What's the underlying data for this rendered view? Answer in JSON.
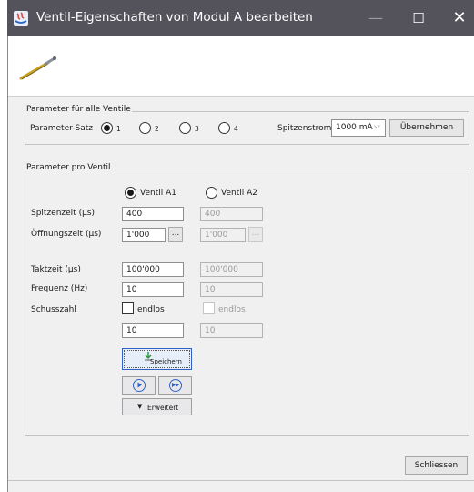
{
  "window": {
    "title": "Ventil-Eigenschaften von Modul A bearbeiten"
  },
  "group_all": {
    "title": "Parameter für alle Ventile",
    "param_set_label": "Parameter-Satz",
    "options": [
      "1",
      "2",
      "3",
      "4"
    ],
    "selected": "1",
    "peak_current_label": "Spitzenstrom",
    "peak_current_value": "1000 mA",
    "apply_label": "Übernehmen"
  },
  "group_per": {
    "title": "Parameter pro Ventil",
    "valve_a1": "Ventil A1",
    "valve_a2": "Ventil A2",
    "selected_valve": "Ventil A1",
    "rows": {
      "spitzenzeit": {
        "label": "Spitzenzeit (µs)",
        "a1": "400",
        "a2": "400"
      },
      "oeffnungszeit": {
        "label": "Öffnungszeit (µs)",
        "a1": "1'000",
        "a2": "1'000"
      },
      "taktzeit": {
        "label": "Taktzeit (µs)",
        "a1": "100'000",
        "a2": "100'000"
      },
      "frequenz": {
        "label": "Frequenz (Hz)",
        "a1": "10",
        "a2": "10"
      },
      "schusszahl": {
        "label": "Schusszahl",
        "endlos": "endlos",
        "endlos_checked": false,
        "a1": "10",
        "a2": "10"
      }
    },
    "ellipsis": "...",
    "save_label": "Speichern",
    "expand_label": "Erweitert"
  },
  "footer": {
    "close_label": "Schliessen"
  },
  "colors": {
    "titlebar": "#54535b",
    "dialog_bg": "#f0f0f0",
    "accent_icon": "#2f62c9"
  }
}
